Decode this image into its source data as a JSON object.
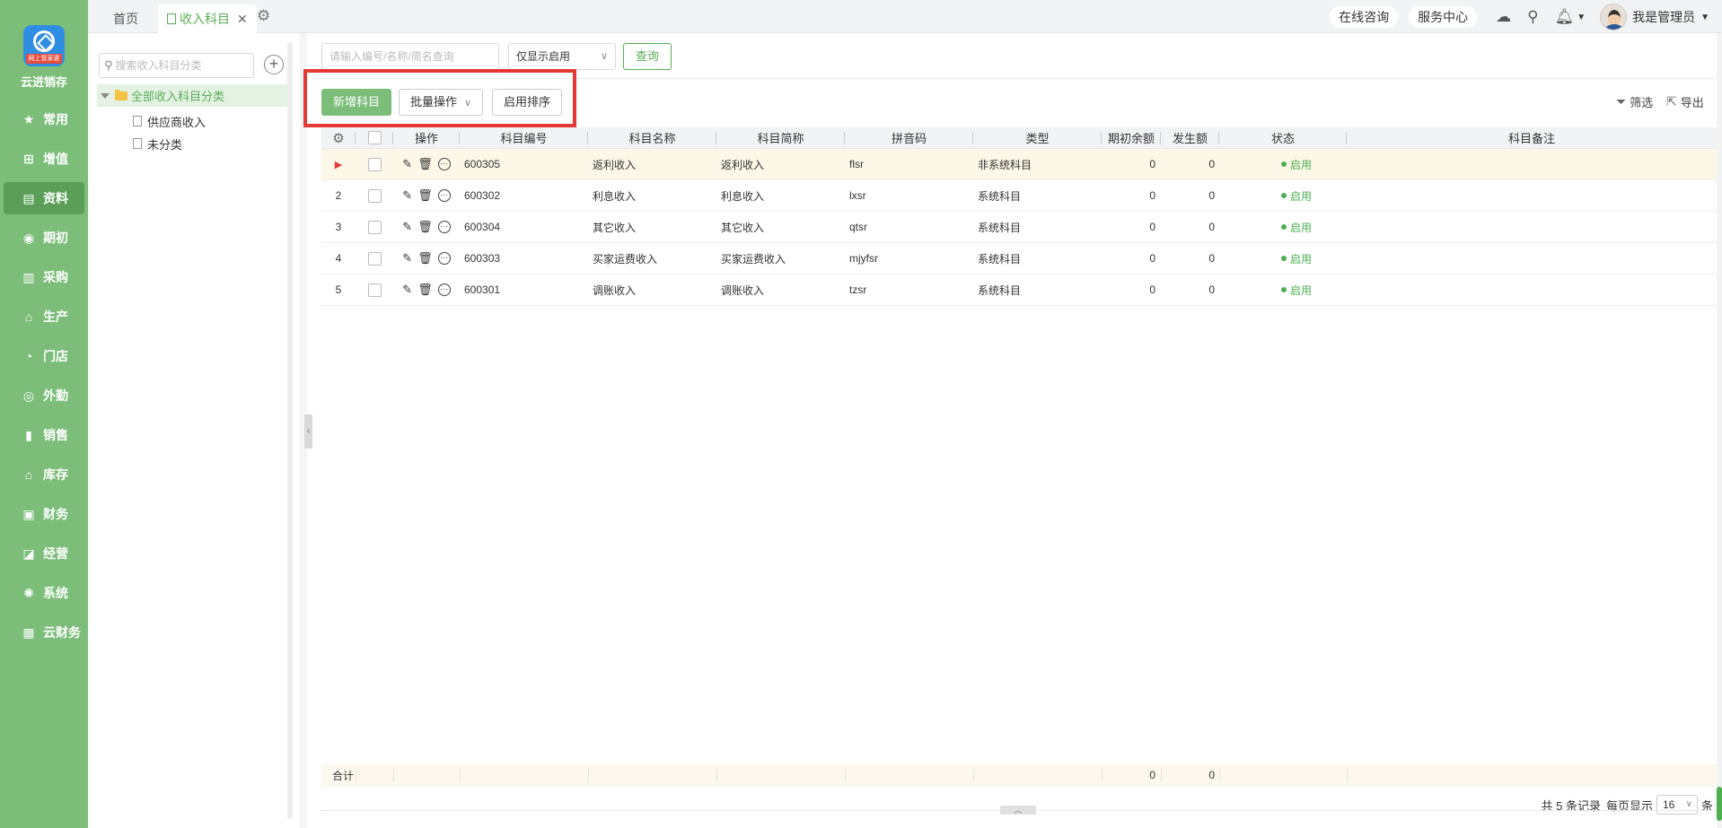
{
  "app": {
    "brand": "云进销存",
    "logo_tag": "网上管家婆"
  },
  "sidebar": {
    "items": [
      {
        "label": "常用",
        "icon": "star-icon"
      },
      {
        "label": "增值",
        "icon": "plus-square-icon"
      },
      {
        "label": "资料",
        "icon": "document-icon",
        "active": true
      },
      {
        "label": "期初",
        "icon": "target-icon"
      },
      {
        "label": "采购",
        "icon": "book-icon"
      },
      {
        "label": "生产",
        "icon": "factory-icon"
      },
      {
        "label": "门店",
        "icon": "pie-icon"
      },
      {
        "label": "外勤",
        "icon": "location-icon"
      },
      {
        "label": "销售",
        "icon": "bar-chart-icon"
      },
      {
        "label": "库存",
        "icon": "warehouse-icon"
      },
      {
        "label": "财务",
        "icon": "wallet-icon"
      },
      {
        "label": "经营",
        "icon": "trend-icon"
      },
      {
        "label": "系统",
        "icon": "gear-icon"
      },
      {
        "label": "云财务",
        "icon": "calculator-icon"
      }
    ]
  },
  "topbar": {
    "tabs": [
      {
        "label": "首页"
      },
      {
        "label": "收入科目",
        "active": true
      }
    ],
    "consult": "在线咨询",
    "service": "服务中心",
    "user": "我是管理员"
  },
  "category": {
    "search_placeholder": "搜索收入科目分类",
    "root": "全部收入科目分类",
    "children": [
      "供应商收入",
      "未分类"
    ]
  },
  "toolbar": {
    "search_placeholder": "请输入编号/名称/简名查询",
    "filter_value": "仅显示启用",
    "query": "查询",
    "add": "新增科目",
    "batch": "批量操作",
    "sort": "启用排序",
    "filter": "筛选",
    "export": "导出"
  },
  "table": {
    "columns": [
      "操作",
      "科目编号",
      "科目名称",
      "科目简称",
      "拼音码",
      "类型",
      "期初余额",
      "发生额",
      "状态",
      "科目备注"
    ],
    "rows": [
      {
        "idx": "",
        "code": "600305",
        "name": "返利收入",
        "short": "返利收入",
        "pinyin": "flsr",
        "type": "非系统科目",
        "init": "0",
        "amount": "0",
        "status": "启用",
        "note": ""
      },
      {
        "idx": "2",
        "code": "600302",
        "name": "利息收入",
        "short": "利息收入",
        "pinyin": "lxsr",
        "type": "系统科目",
        "init": "0",
        "amount": "0",
        "status": "启用",
        "note": ""
      },
      {
        "idx": "3",
        "code": "600304",
        "name": "其它收入",
        "short": "其它收入",
        "pinyin": "qtsr",
        "type": "系统科目",
        "init": "0",
        "amount": "0",
        "status": "启用",
        "note": ""
      },
      {
        "idx": "4",
        "code": "600303",
        "name": "买家运费收入",
        "short": "买家运费收入",
        "pinyin": "mjyfsr",
        "type": "系统科目",
        "init": "0",
        "amount": "0",
        "status": "启用",
        "note": ""
      },
      {
        "idx": "5",
        "code": "600301",
        "name": "调账收入",
        "short": "调账收入",
        "pinyin": "tzsr",
        "type": "系统科目",
        "init": "0",
        "amount": "0",
        "status": "启用",
        "note": ""
      }
    ],
    "total_label": "合计",
    "total_init": "0",
    "total_amount": "0"
  },
  "pager": {
    "summary": "共 5 条记录",
    "per_page_label": "每页显示",
    "per_page": "16",
    "unit": "条"
  },
  "colors": {
    "sidebar": "#7cbd7a",
    "accent": "#5aad58",
    "highlight_border": "#e53935",
    "logo": "#2f8de4"
  }
}
